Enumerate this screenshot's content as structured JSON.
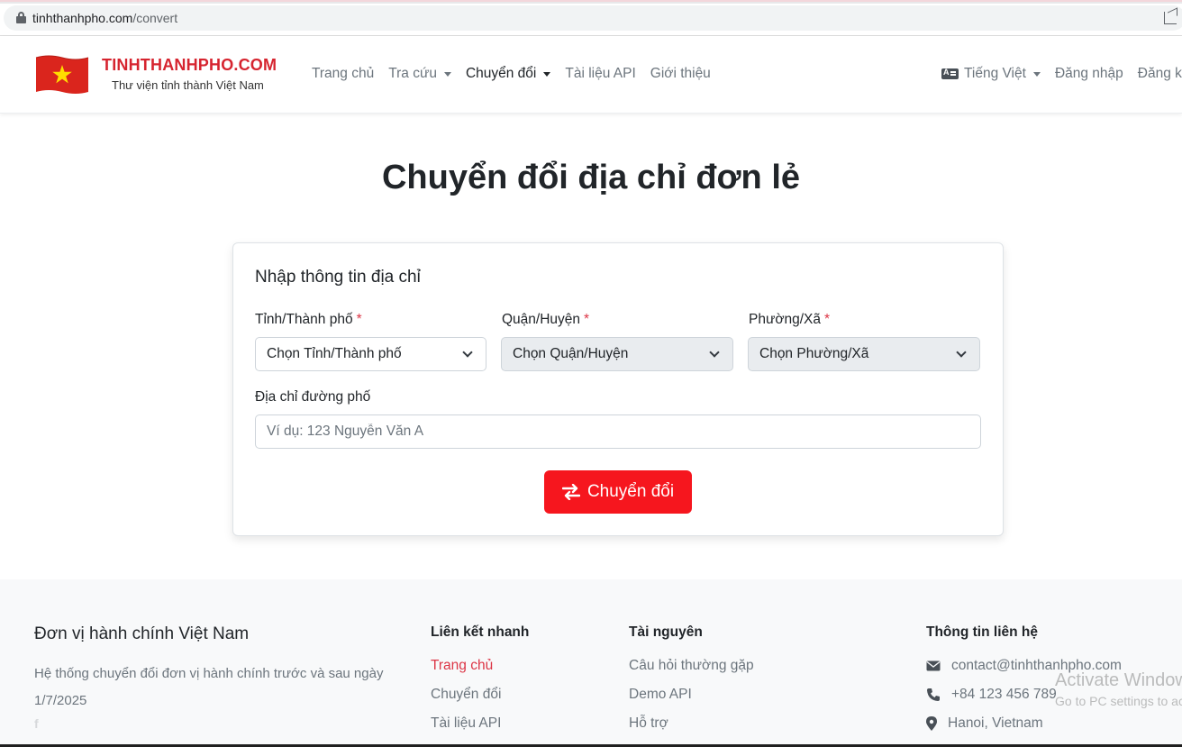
{
  "browser": {
    "url_domain": "tinhthanhpho.com",
    "url_path": "/convert"
  },
  "brand": {
    "name": "TINHTHANHPHO.COM",
    "tagline": "Thư viện tỉnh thành Việt Nam"
  },
  "nav": {
    "items": [
      {
        "label": "Trang chủ"
      },
      {
        "label": "Tra cứu"
      },
      {
        "label": "Chuyển đổi"
      },
      {
        "label": "Tài liệu API"
      },
      {
        "label": "Giới thiệu"
      }
    ],
    "language": "Tiếng Việt",
    "login": "Đăng nhập",
    "register": "Đăng k"
  },
  "page": {
    "title": "Chuyển đổi địa chỉ đơn lẻ"
  },
  "form": {
    "heading": "Nhập thông tin địa chỉ",
    "required_mark": "*",
    "province_label": "Tỉnh/Thành phố",
    "province_value": "Chọn Tỉnh/Thành phố",
    "district_label": "Quận/Huyện",
    "district_value": "Chọn Quận/Huyện",
    "ward_label": "Phường/Xã",
    "ward_value": "Chọn Phường/Xã",
    "street_label": "Địa chỉ đường phố",
    "street_placeholder": "Ví dụ: 123 Nguyễn Văn A",
    "submit_label": "Chuyển đổi"
  },
  "footer": {
    "title": "Đơn vị hành chính Việt Nam",
    "description": "Hệ thống chuyển đổi đơn vị hành chính trước và sau ngày 1/7/2025",
    "social": "f",
    "quick_links_heading": "Liên kết nhanh",
    "quick_links": [
      "Trang chủ",
      "Chuyển đổi",
      "Tài liệu API"
    ],
    "resources_heading": "Tài nguyên",
    "resources": [
      "Câu hỏi thường gặp",
      "Demo API",
      "Hỗ trợ"
    ],
    "contact_heading": "Thông tin liên hệ",
    "email": "contact@tinhthanhpho.com",
    "phone": "+84 123 456 789",
    "location": "Hanoi, Vietnam"
  },
  "watermark": {
    "line1": "Activate Windows",
    "line2": "Go to PC settings to activate Windows."
  },
  "colors": {
    "brand_red": "#d6242f",
    "button_red": "#f6161e",
    "link_red": "#dc3545",
    "flag_red": "#da251d",
    "flag_star": "#ffde00"
  }
}
